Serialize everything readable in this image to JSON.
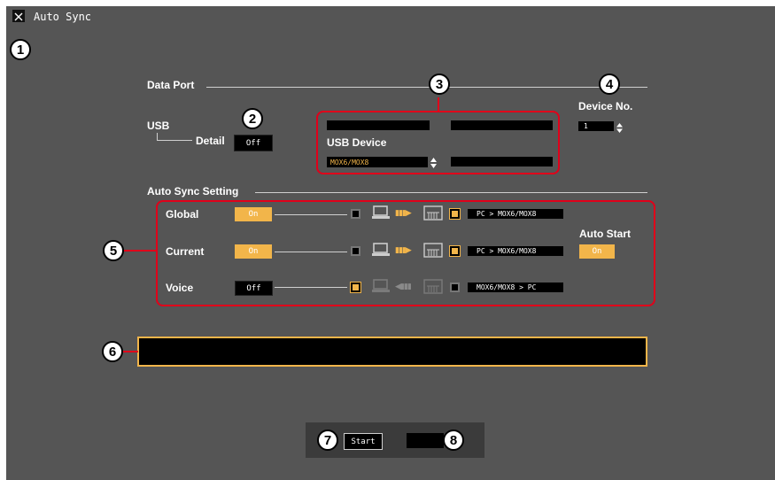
{
  "window": {
    "title": "Auto Sync"
  },
  "callouts": [
    "1",
    "2",
    "3",
    "4",
    "5",
    "6",
    "7",
    "8"
  ],
  "data_port": {
    "label": "Data Port",
    "usb_label": "USB",
    "detail_label": "Detail",
    "detail_value": "Off",
    "usb_device_label": "USB Device",
    "usb_device_value": "MOX6/MOX8",
    "device_no_label": "Device No.",
    "device_no_value": "1"
  },
  "auto_sync": {
    "label": "Auto Sync Setting",
    "rows": [
      {
        "name": "Global",
        "state": "On",
        "route": "PC > MOX6/MOX8"
      },
      {
        "name": "Current",
        "state": "On",
        "route": "PC > MOX6/MOX8"
      },
      {
        "name": "Voice",
        "state": "Off",
        "route": "MOX6/MOX8 > PC"
      }
    ],
    "auto_start_label": "Auto Start",
    "auto_start_value": "On"
  },
  "message_bar": {
    "text": ""
  },
  "footer": {
    "start_label": "Start",
    "status": ""
  },
  "colors": {
    "accent": "#f2b54a",
    "callout_line": "#e0001a",
    "panel": "#555555"
  }
}
